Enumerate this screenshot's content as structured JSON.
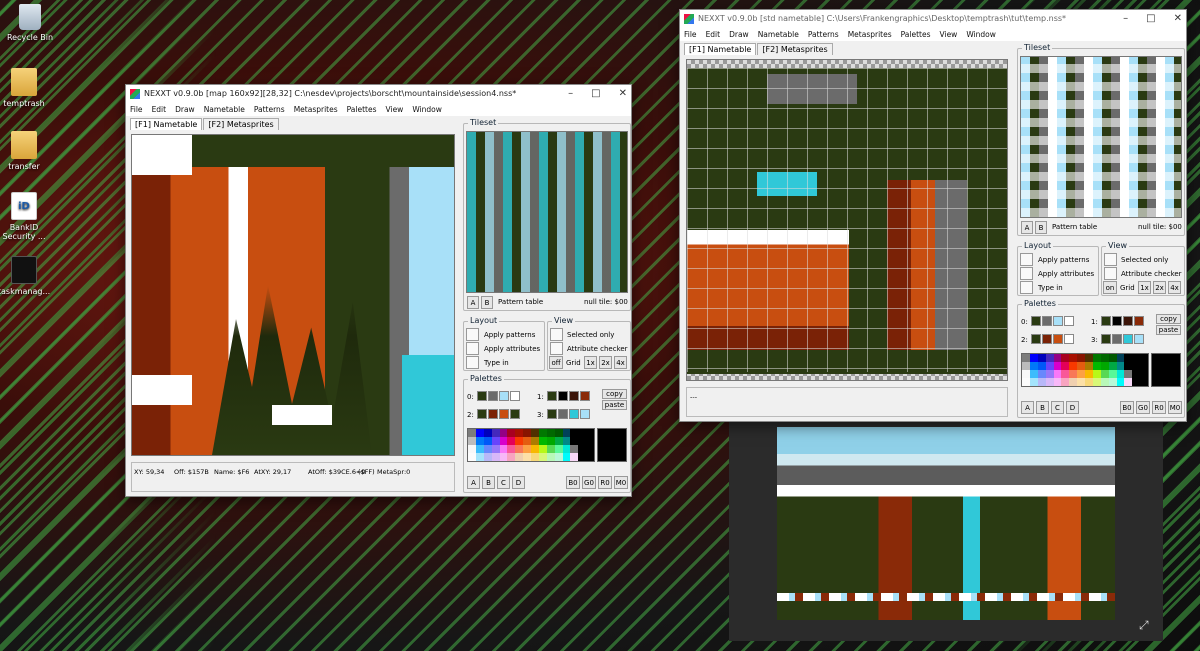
{
  "desktop": {
    "icons": [
      {
        "id": "recycle",
        "label": "Recycle Bin"
      },
      {
        "id": "temptrash",
        "label": "temptrash"
      },
      {
        "id": "transfer",
        "label": "transfer"
      },
      {
        "id": "bankid",
        "label": "BankID Security ..."
      },
      {
        "id": "taskmanager",
        "label": "taskmanag..."
      }
    ]
  },
  "win1": {
    "title": "NEXXT v0.9.0b  [map 160x92][28,32] C:\\nesdev\\projects\\borscht\\mountainside\\session4.nss*",
    "menu": [
      "File",
      "Edit",
      "Draw",
      "Nametable",
      "Patterns",
      "Metasprites",
      "Palettes",
      "View",
      "Window"
    ],
    "tabs": [
      "[F1] Nametable",
      "[F2] Metasprites"
    ],
    "tileset_label": "Tileset",
    "pattern_table_label": "Pattern table",
    "null_tile": "null tile: $00",
    "ab": [
      "A",
      "B"
    ],
    "layout": {
      "label": "Layout",
      "apply_patterns": "Apply patterns",
      "apply_attributes": "Apply attributes",
      "type_in": "Type in"
    },
    "view": {
      "label": "View",
      "selected_only": "Selected only",
      "attribute_checker": "Attribute checker",
      "off": "off",
      "grid": "Grid",
      "zoom": [
        "1x",
        "2x",
        "4x"
      ]
    },
    "palettes": {
      "label": "Palettes",
      "rows": [
        "0:",
        "1:",
        "2:",
        "3:"
      ],
      "copy": "copy",
      "paste": "paste",
      "sets": [
        [
          "#2a3a12",
          "#6b6b6b",
          "#a8e0f8",
          "#ffffff"
        ],
        [
          "#2a3a12",
          "#000000",
          "#3b1408",
          "#8a2a08"
        ],
        [
          "#2a3a12",
          "#7a2206",
          "#c84e10",
          "#2a3a12"
        ],
        [
          "#2a3a12",
          "#6b6b6b",
          "#30c8d8",
          "#a8e0f8"
        ]
      ]
    },
    "bottom_buttons": [
      "A",
      "B",
      "C",
      "D",
      "B0",
      "G0",
      "R0",
      "M0"
    ],
    "status": {
      "xy": "XY: 59,34",
      "off": "Off: $157B",
      "name": "Name: $F6",
      "atxy": "AtXY: 29,17",
      "atoff": "AtOff: $39CE.6=0",
      "ff": "($FF)",
      "metaspr": "MetaSpr:0"
    }
  },
  "win2": {
    "title": "NEXXT v0.9.0b  [std nametable] C:\\Users\\Frankengraphics\\Desktop\\temptrash\\tut\\temp.nss*",
    "menu": [
      "File",
      "Edit",
      "Draw",
      "Nametable",
      "Patterns",
      "Metasprites",
      "Palettes",
      "View",
      "Window"
    ],
    "tabs": [
      "[F1] Nametable",
      "[F2] Metasprites"
    ],
    "tileset_label": "Tileset",
    "pattern_table_label": "Pattern table",
    "null_tile": "null tile: $00",
    "ab": [
      "A",
      "B"
    ],
    "layout": {
      "label": "Layout",
      "apply_patterns": "Apply patterns",
      "apply_attributes": "Apply attributes",
      "type_in": "Type in"
    },
    "view": {
      "label": "View",
      "selected_only": "Selected only",
      "attribute_checker": "Attribute checker",
      "off": "on",
      "grid": "Grid",
      "zoom": [
        "1x",
        "2x",
        "4x"
      ]
    },
    "palettes": {
      "label": "Palettes",
      "rows": [
        "0:",
        "1:",
        "2:",
        "3:"
      ],
      "copy": "copy",
      "paste": "paste",
      "sets": [
        [
          "#2a3a12",
          "#6b6b6b",
          "#a8e0f8",
          "#ffffff"
        ],
        [
          "#2a3a12",
          "#000000",
          "#3b1408",
          "#8a2a08"
        ],
        [
          "#2a3a12",
          "#7a2206",
          "#c84e10",
          "#ffffff"
        ],
        [
          "#2a3a12",
          "#6b6b6b",
          "#30c8d8",
          "#a8e0f8"
        ]
      ]
    },
    "bottom_buttons": [
      "A",
      "B",
      "C",
      "D",
      "B0",
      "G0",
      "R0",
      "M0"
    ],
    "status_text": "---"
  },
  "nes_palette": [
    "#7c7c7c",
    "#0000fc",
    "#0000bc",
    "#4428bc",
    "#940084",
    "#a80020",
    "#a81000",
    "#881400",
    "#503000",
    "#007800",
    "#006800",
    "#005800",
    "#004058",
    "#000000",
    "#000000",
    "#000000",
    "#bcbcbc",
    "#0078f8",
    "#0058f8",
    "#6844fc",
    "#d800cc",
    "#e40058",
    "#f83800",
    "#e45c10",
    "#ac7c00",
    "#00b800",
    "#00a800",
    "#00a844",
    "#008888",
    "#000000",
    "#000000",
    "#000000",
    "#f8f8f8",
    "#3cbcfc",
    "#6888fc",
    "#9878f8",
    "#f878f8",
    "#f85898",
    "#f87858",
    "#fca044",
    "#f8b800",
    "#b8f818",
    "#58d854",
    "#58f898",
    "#00e8d8",
    "#787878",
    "#000000",
    "#000000",
    "#fcfcfc",
    "#a4e4fc",
    "#b8b8f8",
    "#d8b8f8",
    "#f8b8f8",
    "#f8a4c0",
    "#f0d0b0",
    "#fce0a8",
    "#f8d878",
    "#d8f878",
    "#b8f8b8",
    "#b8f8d8",
    "#00fcfc",
    "#f8d8f8",
    "#000000",
    "#000000"
  ],
  "preview_expand_icon": "expand-icon"
}
